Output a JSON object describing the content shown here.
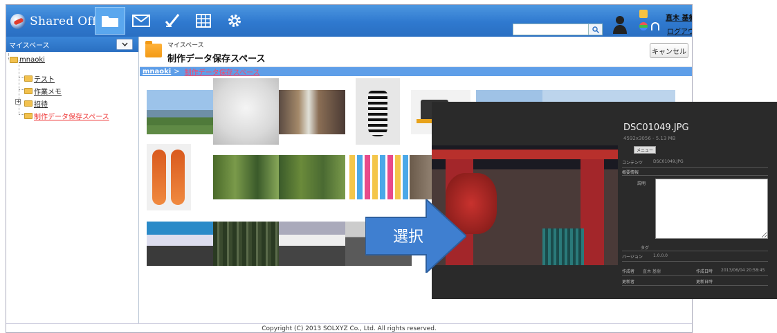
{
  "header": {
    "logo_text": "Shared Office",
    "nav_icons": [
      "folder-icon",
      "mail-icon",
      "pen-icon",
      "grid-icon",
      "gear-icon"
    ],
    "search": {
      "value": "",
      "placeholder": ""
    },
    "user_name": "直木 基樹",
    "logout_label": "ログアウト"
  },
  "sidebar": {
    "title": "マイスペース",
    "tree": {
      "root": "mnaoki",
      "items": [
        "テスト",
        "作業メモ",
        "招待",
        "制作データ保存スペース"
      ],
      "selected": "制作データ保存スペース"
    }
  },
  "main": {
    "subtitle": "マイスペース",
    "title": "制作データ保存スペース",
    "cancel_label": "キャンセル",
    "breadcrumb": {
      "root": "mnaoki",
      "separator": ">",
      "current": "制作データ保存スペース"
    }
  },
  "footer": {
    "copyright": "Copyright (C) 2013 SOLXYZ Co., Ltd. All rights reserved."
  },
  "preview": {
    "file_name": "DSC01049.JPG",
    "file_meta": "4592x3056 - 5.13 MB",
    "menu_label": "メニュー",
    "content_label": "コンテンツ",
    "content_value": "DSC01049.JPG",
    "section_label": "概要情報",
    "description_label": "説明",
    "description_value": "",
    "tag_label": "タグ",
    "version_label": "バージョン",
    "version_value": "1.0.0.0",
    "creator_label": "作成者",
    "creator_value": "直木 基樹",
    "created_label": "作成日時",
    "created_value": "2013/06/04 20:58:45",
    "updater_label": "更新者",
    "updated_label": "更新日時"
  },
  "annotation": {
    "label": "選択"
  },
  "colors": {
    "header_blue": "#2f79cf",
    "breadcrumb_blue": "#5e9ee8",
    "arrow_blue": "#3f7fd0",
    "selected_red": "#ee3333"
  }
}
